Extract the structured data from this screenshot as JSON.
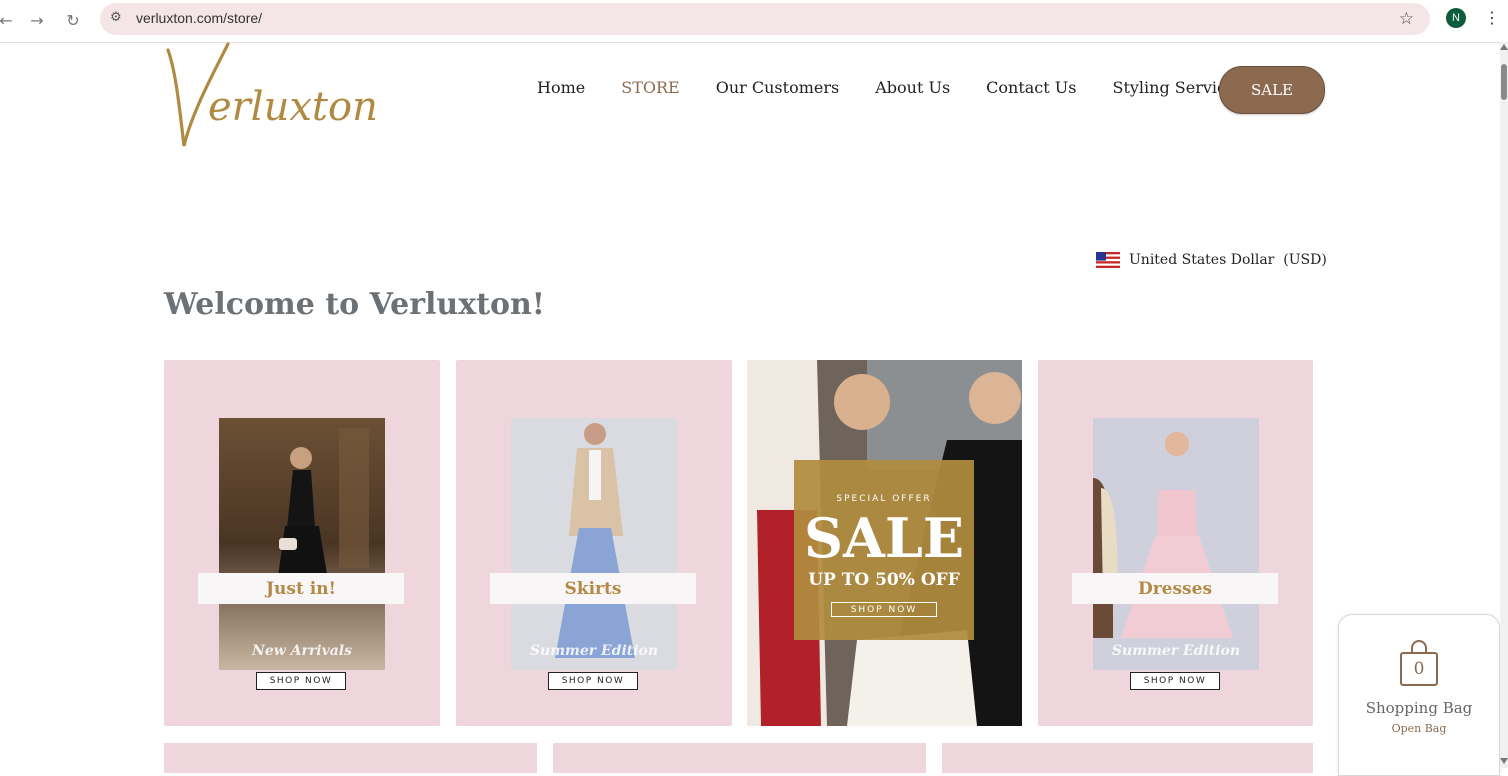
{
  "browser": {
    "url": "verluxton.com/store/",
    "profile_initial": "N"
  },
  "site": {
    "logo_text": "Verluxton",
    "nav": [
      "Home",
      "STORE",
      "Our Customers",
      "About Us",
      "Contact Us",
      "Styling Services"
    ],
    "active_nav": "STORE",
    "sale_button": "SALE",
    "currency": "United States Dollar  (USD)",
    "welcome": "Welcome to Verluxton!",
    "accent_color": "#8c6a4f",
    "gold_color": "#b38a45",
    "card_bg": "#efd6dd"
  },
  "cards": [
    {
      "label": "Just in!",
      "subtitle": "New Arrivals",
      "button": "SHOP NOW"
    },
    {
      "label": "Skirts",
      "subtitle": "Summer Edition",
      "button": "SHOP NOW"
    },
    {
      "label": "Dresses",
      "subtitle": "Summer Edition",
      "button": "SHOP NOW"
    }
  ],
  "promo": {
    "special": "SPECIAL OFFER",
    "headline": "SALE",
    "sub": "UP TO 50% OFF",
    "button": "SHOP NOW"
  },
  "bag": {
    "count": "0",
    "title": "Shopping Bag",
    "action": "Open Bag"
  },
  "icons": [
    "back-arrow-icon",
    "forward-arrow-icon",
    "reload-icon",
    "site-info-icon",
    "bookmark-star-icon",
    "kebab-menu-icon",
    "us-flag-icon",
    "shopping-bag-icon"
  ]
}
